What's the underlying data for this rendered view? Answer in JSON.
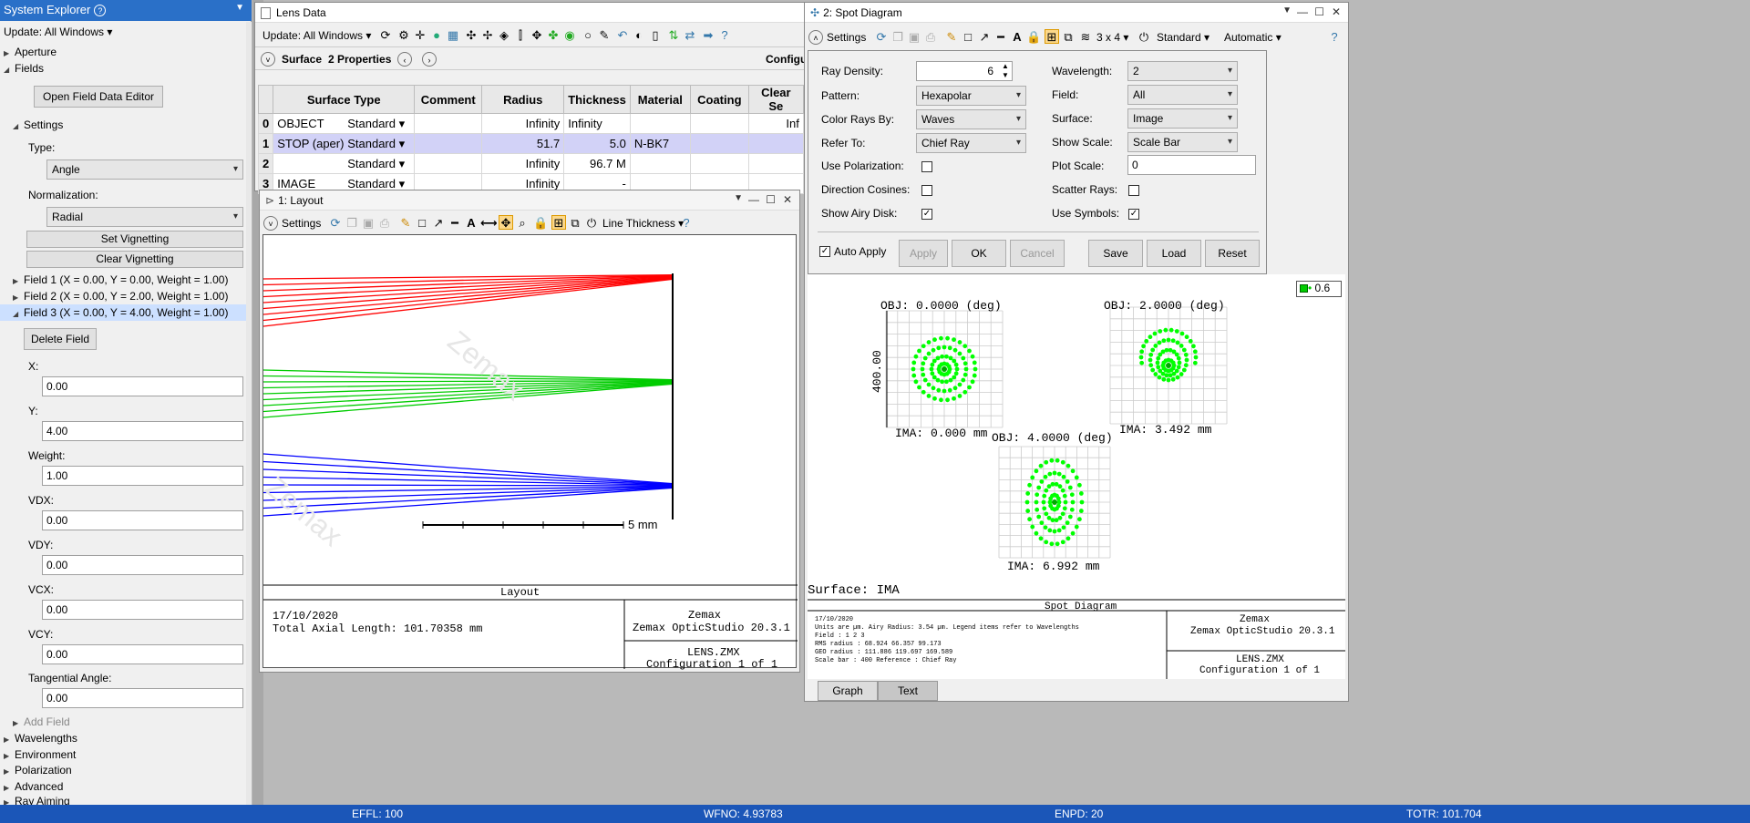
{
  "system_explorer": {
    "title": "System Explorer",
    "update": "Update: All Windows",
    "aperture": "Aperture",
    "fields": "Fields",
    "open_field_editor": "Open Field Data Editor",
    "settings": "Settings",
    "type_label": "Type:",
    "type_value": "Angle",
    "norm_label": "Normalization:",
    "norm_value": "Radial",
    "set_vignetting": "Set Vignetting",
    "clear_vignetting": "Clear Vignetting",
    "field1": "Field 1 (X = 0.00, Y = 0.00, Weight = 1.00)",
    "field2": "Field 2 (X = 0.00, Y = 2.00, Weight = 1.00)",
    "field3": "Field 3 (X = 0.00, Y = 4.00, Weight = 1.00)",
    "delete_field": "Delete Field",
    "x_label": "X:",
    "x_value": "0.00",
    "y_label": "Y:",
    "y_value": "4.00",
    "weight_label": "Weight:",
    "weight_value": "1.00",
    "vdx_label": "VDX:",
    "vdx_value": "0.00",
    "vdy_label": "VDY:",
    "vdy_value": "0.00",
    "vcx_label": "VCX:",
    "vcx_value": "0.00",
    "vcy_label": "VCY:",
    "vcy_value": "0.00",
    "tan_label": "Tangential Angle:",
    "tan_value": "0.00",
    "add_field": "Add Field",
    "wavelengths": "Wavelengths",
    "environment": "Environment",
    "polarization": "Polarization",
    "advanced": "Advanced",
    "ray_aiming": "Ray Aiming"
  },
  "lens_data": {
    "title": "Lens Data",
    "update": "Update: All Windows",
    "surface_tab": "Surface",
    "properties": "2 Properties",
    "config": "Configu",
    "headers": [
      "Surface Type",
      "Comment",
      "Radius",
      "Thickness",
      "Material",
      "Coating",
      "Clear Se"
    ],
    "rows": [
      {
        "num": "0",
        "name": "OBJECT",
        "type": "Standard",
        "radius": "Infinity",
        "thickness": "Infinity",
        "material": "",
        "clear": "Inf"
      },
      {
        "num": "1",
        "name": "STOP (aper)",
        "type": "Standard",
        "radius": "51.7",
        "thickness": "5.0",
        "material": "N-BK7",
        "clear": ""
      },
      {
        "num": "2",
        "name": "",
        "type": "Standard",
        "radius": "Infinity",
        "thickness": "96.7",
        "solve": "M",
        "material": "",
        "clear": ""
      },
      {
        "num": "3",
        "name": "IMAGE",
        "type": "Standard",
        "radius": "Infinity",
        "thickness": "-",
        "material": "",
        "clear": ""
      }
    ]
  },
  "layout": {
    "title": "1: Layout",
    "settings": "Settings",
    "line_thickness": "Line Thickness",
    "scale": "5 mm",
    "plot_title": "Layout",
    "date": "17/10/2020",
    "axial": "Total Axial Length:  101.70358 mm",
    "company": "Zemax",
    "product": "Zemax OpticStudio 20.3.1",
    "file": "LENS.ZMX",
    "config": "Configuration 1 of 1"
  },
  "spot": {
    "title": "2: Spot Diagram",
    "settings": "Settings",
    "grid": "3 x 4",
    "standard": "Standard",
    "automatic": "Automatic",
    "ray_density_label": "Ray Density:",
    "ray_density": "6",
    "pattern_label": "Pattern:",
    "pattern": "Hexapolar",
    "color_label": "Color Rays By:",
    "color": "Waves",
    "refer_label": "Refer To:",
    "refer": "Chief Ray",
    "use_pol": "Use Polarization:",
    "dir_cos": "Direction Cosines:",
    "show_airy": "Show Airy Disk:",
    "wavelength_label": "Wavelength:",
    "wavelength": "2",
    "field_label": "Field:",
    "field": "All",
    "surface_label": "Surface:",
    "surface": "Image",
    "show_scale_label": "Show Scale:",
    "show_scale": "Scale Bar",
    "plot_scale_label": "Plot Scale:",
    "plot_scale": "0",
    "scatter": "Scatter Rays:",
    "use_symbols": "Use Symbols:",
    "auto_apply": "Auto Apply",
    "apply": "Apply",
    "ok": "OK",
    "cancel": "Cancel",
    "save": "Save",
    "load": "Load",
    "reset": "Reset",
    "legend_value": "0.6",
    "obj1": "OBJ: 0.0000 (deg)",
    "ima1": "IMA: 0.000 mm",
    "obj2": "OBJ: 2.0000 (deg)",
    "ima2": "IMA: 3.492 mm",
    "obj3": "OBJ: 4.0000 (deg)",
    "ima3": "IMA: 6.992 mm",
    "scale_label": "400.00",
    "surface_line": "Surface: IMA",
    "plot_title": "Spot Diagram",
    "info1": "17/10/2020",
    "info2": "Units are µm.          Airy Radius: 3.54 µm. Legend items refer to Wavelengths",
    "info3": "Field      :         1          2          3",
    "info4": "RMS radius :    68.924    66.357    99.173",
    "info5": "GEO radius :   111.886   119.697   169.589",
    "info6": "Scale bar  : 400      Reference  : Chief Ray",
    "company": "Zemax",
    "product": "Zemax OpticStudio 20.3.1",
    "file": "LENS.ZMX",
    "config": "Configuration 1 of 1",
    "tab_graph": "Graph",
    "tab_text": "Text"
  },
  "status": {
    "effl": "EFFL: 100",
    "wfno": "WFNO: 4.93783",
    "enpd": "ENPD: 20",
    "totr": "TOTR: 101.704"
  },
  "colors": {
    "title_blue": "#2a70c8",
    "status_blue": "#1b56b8",
    "ray_red": "#ff0000",
    "ray_green": "#00cc00",
    "ray_blue": "#0000ff",
    "spot_green": "#00ff00"
  }
}
